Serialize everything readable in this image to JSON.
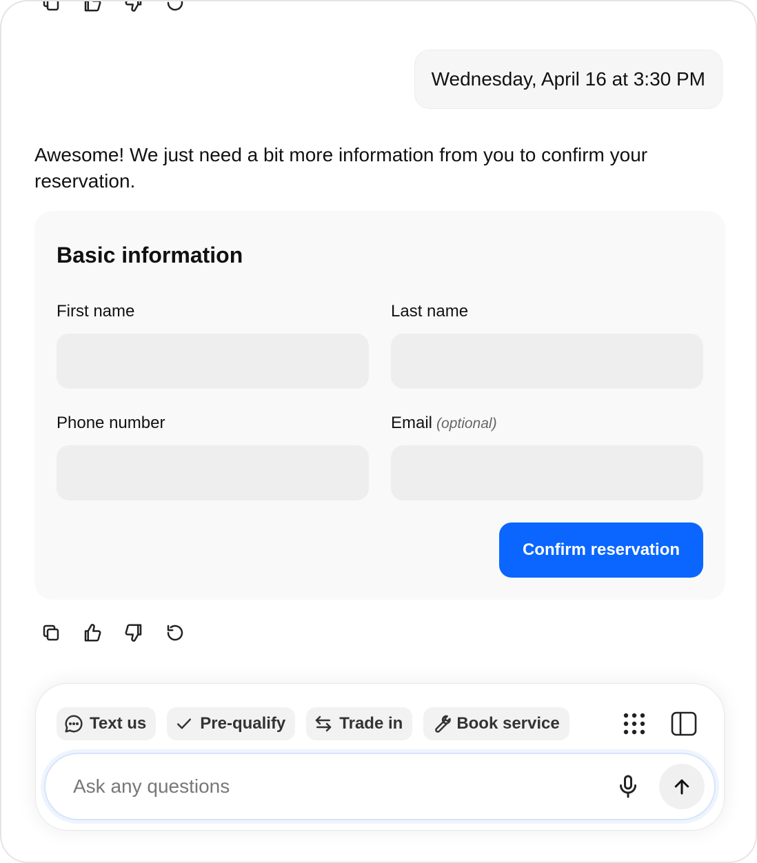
{
  "conversation": {
    "user_message": "Wednesday, April 16 at 3:30 PM",
    "assistant_message": "Awesome! We just need a bit more information from you to confirm your reservation."
  },
  "message_actions": {
    "icons": [
      "copy-icon",
      "thumbs-up-icon",
      "thumbs-down-icon",
      "regenerate-icon"
    ]
  },
  "form": {
    "title": "Basic information",
    "first_name": {
      "label": "First name",
      "value": ""
    },
    "last_name": {
      "label": "Last name",
      "value": ""
    },
    "phone": {
      "label": "Phone number",
      "value": ""
    },
    "email": {
      "label": "Email",
      "optional_note": "(optional)",
      "value": ""
    },
    "submit_label": "Confirm reservation"
  },
  "composer": {
    "chips": [
      {
        "label": "Text us",
        "icon": "chat-bubble-icon"
      },
      {
        "label": "Pre-qualify",
        "icon": "check-icon"
      },
      {
        "label": "Trade in",
        "icon": "swap-arrows-icon"
      },
      {
        "label": "Book service",
        "icon": "wrench-icon"
      }
    ],
    "tools": [
      "grid-dots-icon",
      "sidebar-panel-icon"
    ],
    "placeholder": "Ask any questions"
  },
  "colors": {
    "primary": "#0a66ff",
    "input_bg": "#eeeeee",
    "card_bg": "#f9f9f9",
    "bubble_bg": "#f6f6f6"
  }
}
